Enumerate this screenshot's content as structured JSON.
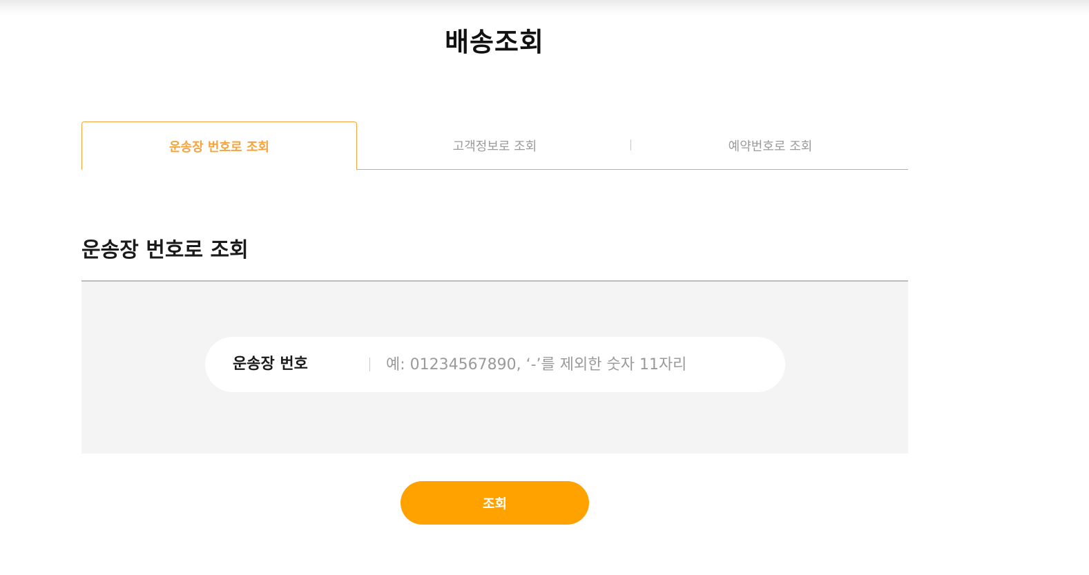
{
  "page": {
    "title": "배송조회"
  },
  "tabs": [
    {
      "label": "운송장 번호로 조회",
      "active": true
    },
    {
      "label": "고객정보로 조회",
      "active": false
    },
    {
      "label": "예약번호로 조회",
      "active": false
    }
  ],
  "section": {
    "title": "운송장 번호로 조회"
  },
  "form": {
    "field_label": "운송장 번호",
    "input_value": "",
    "input_placeholder": "예: 01234567890, ‘-’를 제외한 숫자 11자리"
  },
  "submit": {
    "label": "조회"
  },
  "colors": {
    "accent": "#f7a33c",
    "button": "#ffa200",
    "panel": "#f4f4f4"
  }
}
